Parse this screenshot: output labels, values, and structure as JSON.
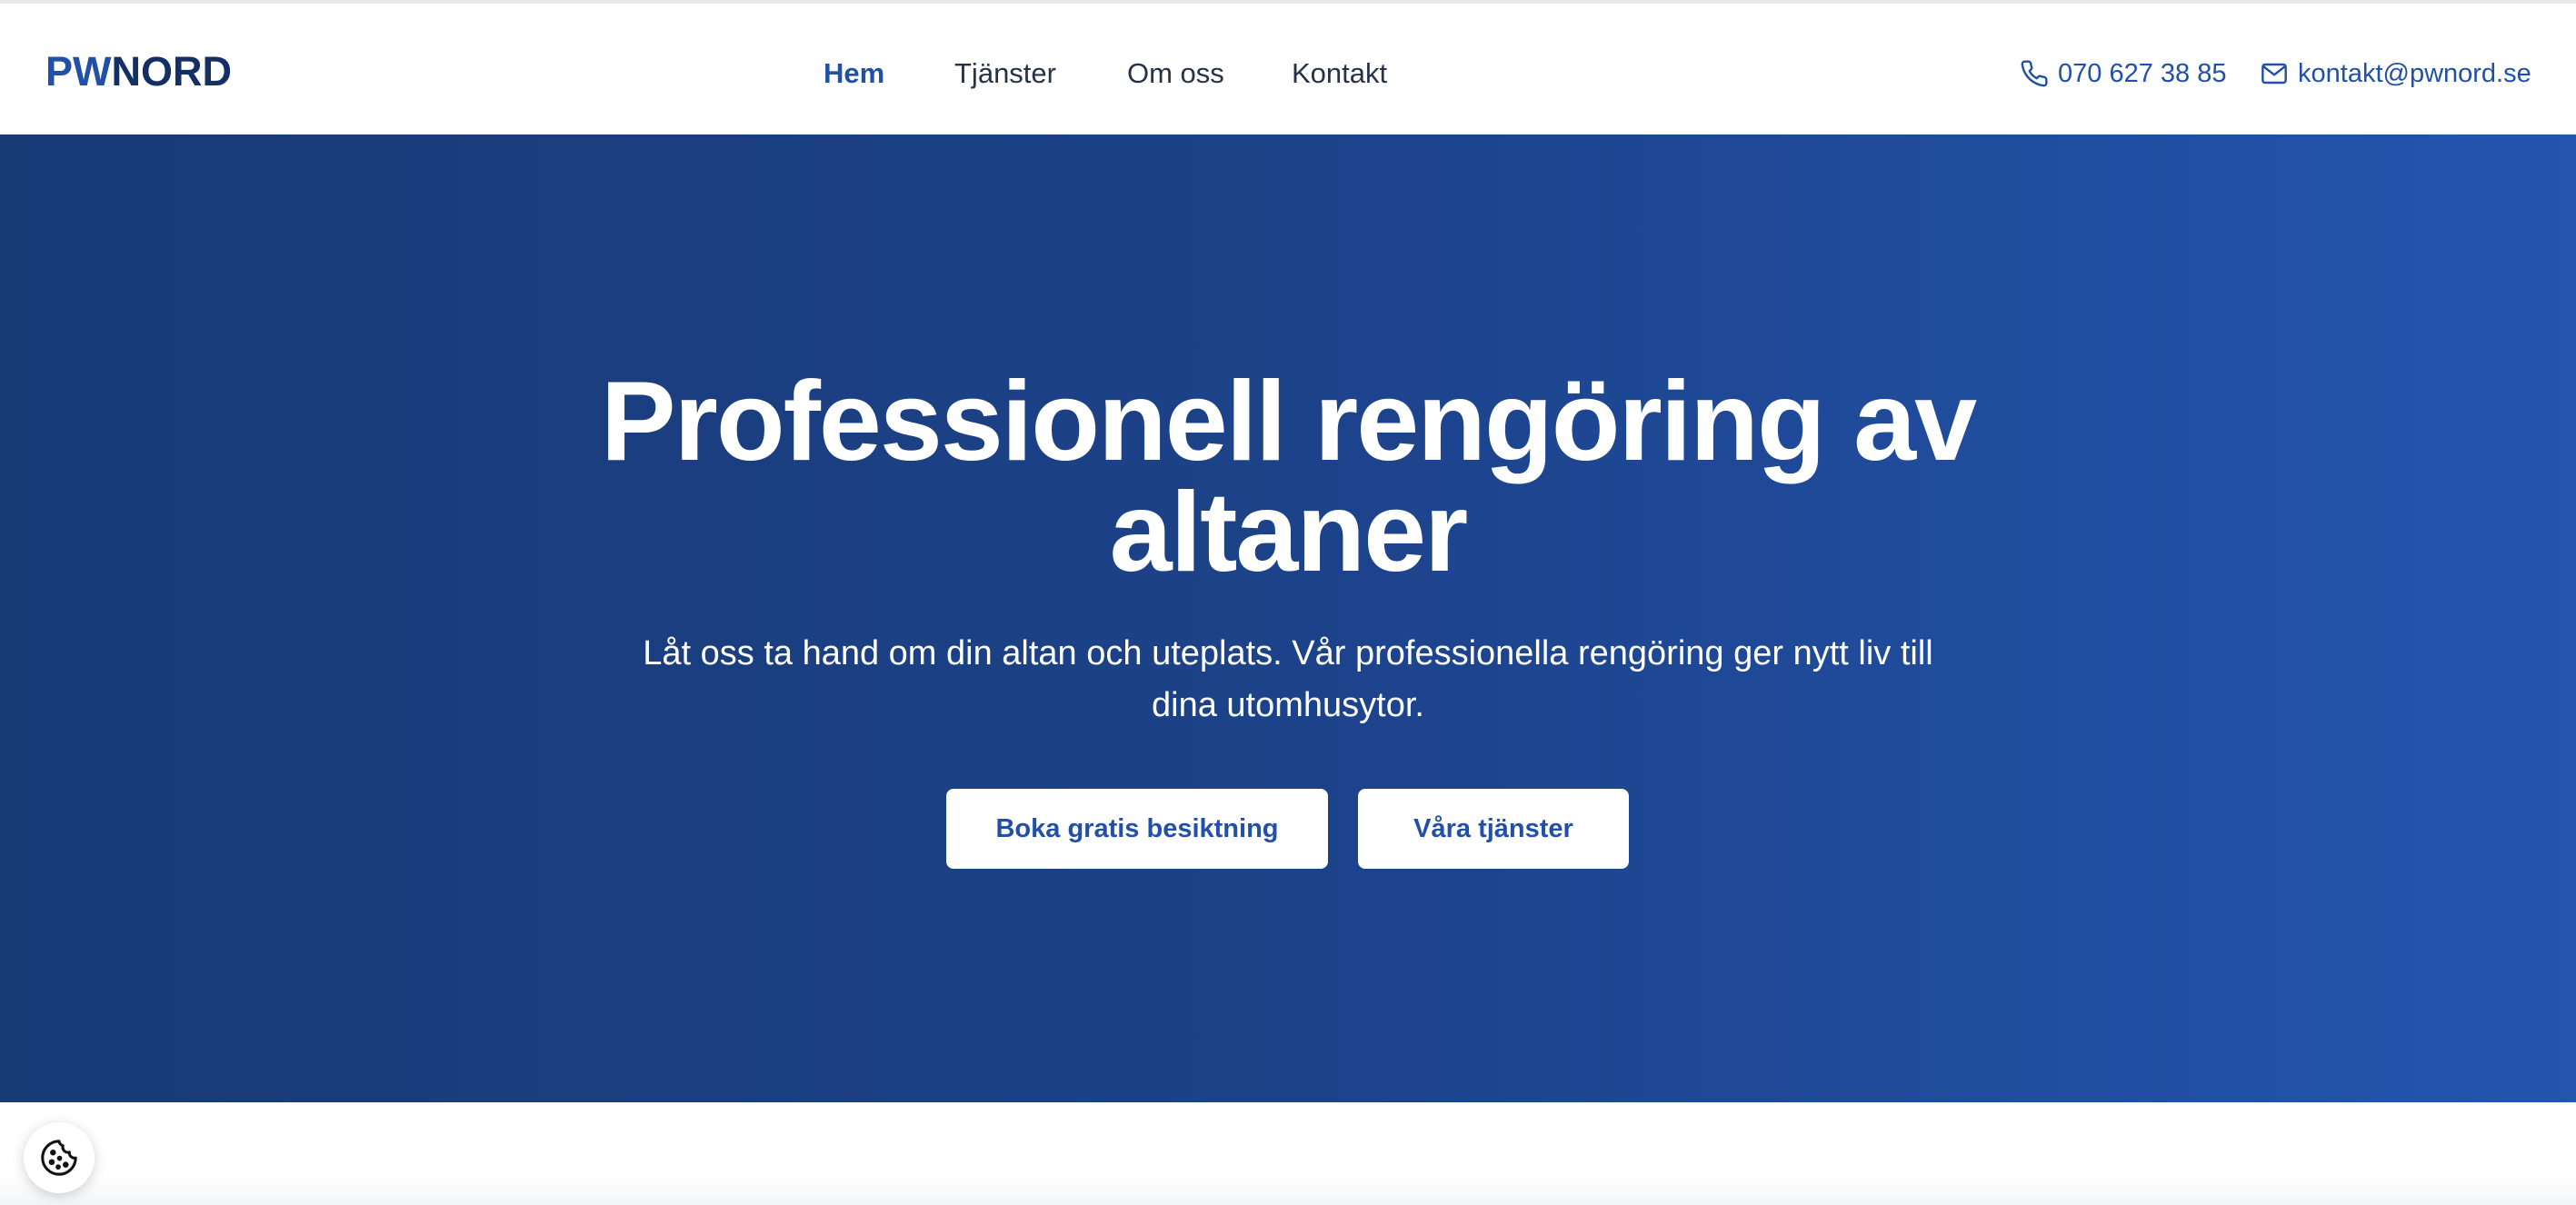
{
  "brand": {
    "logo_part1": "PW",
    "logo_part2": "NORD",
    "primary_color": "#2150a8",
    "dark_color": "#132f64"
  },
  "nav": {
    "items": [
      {
        "label": "Hem",
        "active": true
      },
      {
        "label": "Tjänster",
        "active": false
      },
      {
        "label": "Om oss",
        "active": false
      },
      {
        "label": "Kontakt",
        "active": false
      }
    ]
  },
  "contact": {
    "phone": "070 627 38 85",
    "phone_icon": "phone-icon",
    "email": "kontakt@pwnord.se",
    "email_icon": "mail-icon"
  },
  "hero": {
    "title_line1": "Professionell rengöring av",
    "title_line2": "altaner",
    "subtitle_line1": "Låt oss ta hand om din altan och uteplats. Vår professionella rengöring ger nytt liv till",
    "subtitle_line2": "dina utomhusytor.",
    "primary_button": "Boka gratis besiktning",
    "secondary_button": "Våra tjänster",
    "gradient_start": "#183a75",
    "gradient_end": "#2455af"
  },
  "cookie": {
    "icon": "cookie-icon"
  }
}
